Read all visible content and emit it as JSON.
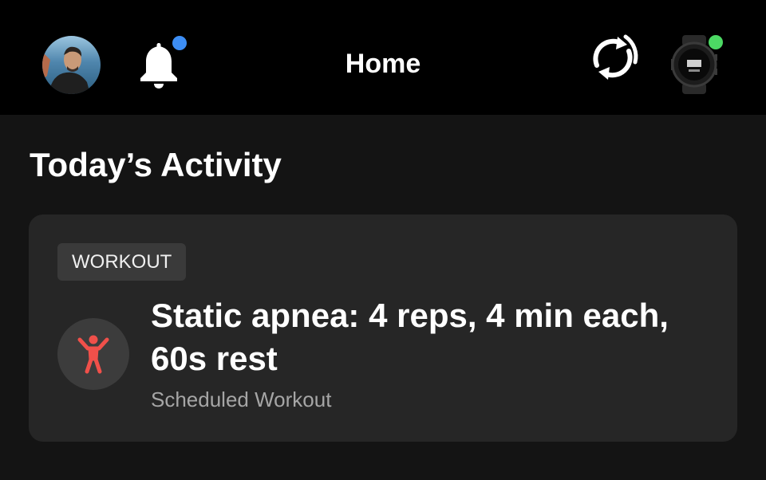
{
  "header": {
    "title": "Home",
    "notification_dot_color": "#3d8ef5",
    "device_status_color": "#4cd964",
    "icons": [
      "profile-avatar",
      "bell-icon",
      "sync-icon",
      "watch-icon"
    ]
  },
  "section": {
    "title": "Today’s Activity"
  },
  "activity_card": {
    "tag": "WORKOUT",
    "icon": "person-jumping-icon",
    "icon_color": "#f0504a",
    "title": "Static apnea: 4 reps, 4 min each, 60s rest",
    "subtitle": "Scheduled Workout"
  }
}
